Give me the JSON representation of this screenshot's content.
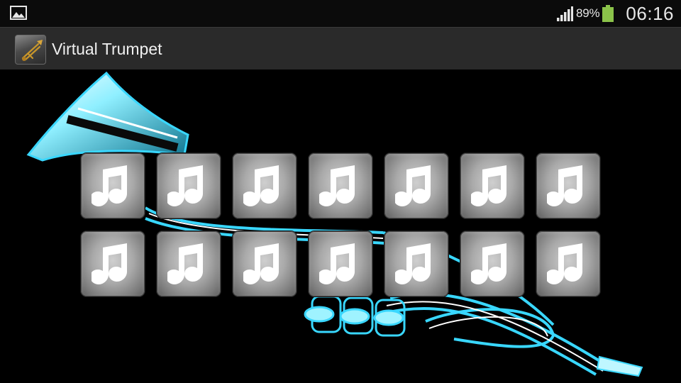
{
  "status_bar": {
    "left_icon": "image-notification-icon",
    "signal_icon": "signal-strength-icon",
    "battery_percent": "89%",
    "battery_icon": "battery-icon",
    "battery_color": "#8bc34a",
    "time": "06:16"
  },
  "action_bar": {
    "app_icon": "trumpet-app-icon",
    "title": "Virtual Trumpet"
  },
  "content": {
    "background": "trumpet-illustration",
    "accent_color": "#39d7ff",
    "sound_buttons": [
      {
        "icon": "music-note-icon"
      },
      {
        "icon": "music-note-icon"
      },
      {
        "icon": "music-note-icon"
      },
      {
        "icon": "music-note-icon"
      },
      {
        "icon": "music-note-icon"
      },
      {
        "icon": "music-note-icon"
      },
      {
        "icon": "music-note-icon"
      },
      {
        "icon": "music-note-icon"
      },
      {
        "icon": "music-note-icon"
      },
      {
        "icon": "music-note-icon"
      },
      {
        "icon": "music-note-icon"
      },
      {
        "icon": "music-note-icon"
      },
      {
        "icon": "music-note-icon"
      },
      {
        "icon": "music-note-icon"
      }
    ]
  }
}
